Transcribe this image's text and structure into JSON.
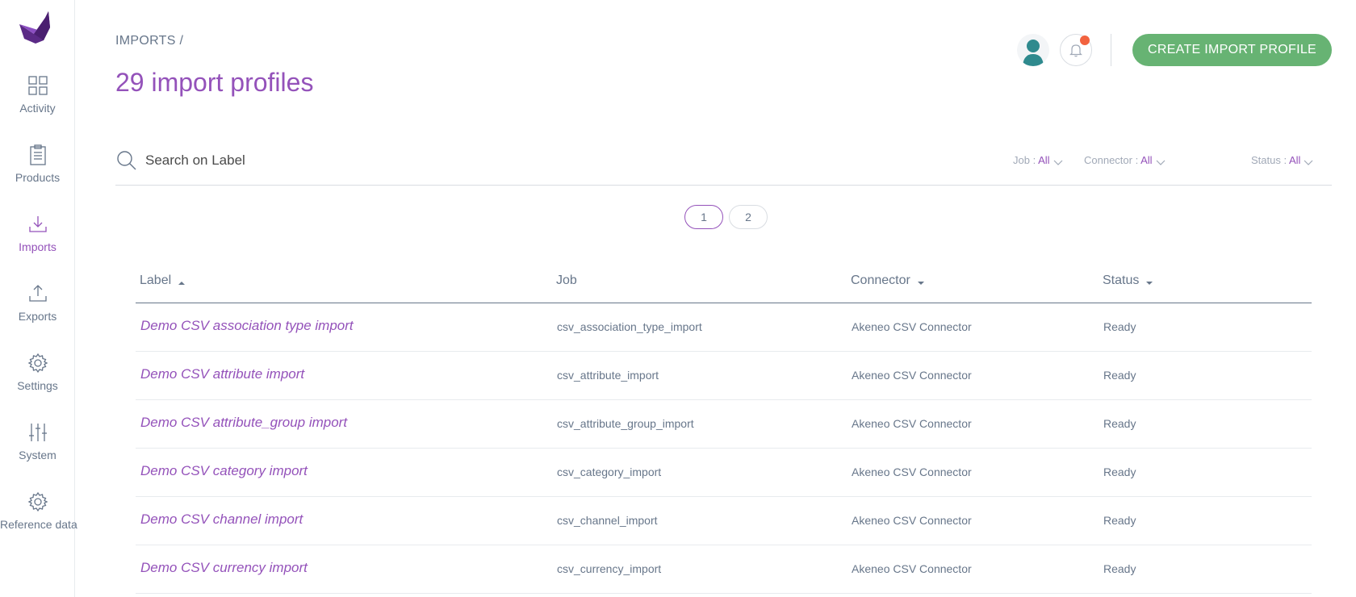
{
  "sidebar": {
    "items": [
      {
        "label": "Activity",
        "icon": "dashboard-grid-icon"
      },
      {
        "label": "Products",
        "icon": "clipboard-icon"
      },
      {
        "label": "Imports",
        "icon": "import-icon",
        "active": true
      },
      {
        "label": "Exports",
        "icon": "export-icon"
      },
      {
        "label": "Settings",
        "icon": "gear-icon"
      },
      {
        "label": "System",
        "icon": "sliders-icon"
      },
      {
        "label": "Reference data",
        "icon": "gear-icon"
      }
    ]
  },
  "header": {
    "breadcrumb": "IMPORTS /",
    "title": "29 import profiles",
    "create_button": "CREATE IMPORT PROFILE"
  },
  "search": {
    "placeholder": "Search on Label"
  },
  "filters": [
    {
      "label": "Job : ",
      "value": "All"
    },
    {
      "label": "Connector : ",
      "value": "All"
    },
    {
      "label": "Status : ",
      "value": "All"
    }
  ],
  "pagination": {
    "pages": [
      "1",
      "2"
    ],
    "current": "1"
  },
  "table": {
    "columns": [
      "Label",
      "Job",
      "Connector",
      "Status"
    ],
    "rows": [
      {
        "label": "Demo CSV association type import",
        "job": "csv_association_type_import",
        "connector": "Akeneo CSV Connector",
        "status": "Ready"
      },
      {
        "label": "Demo CSV attribute import",
        "job": "csv_attribute_import",
        "connector": "Akeneo CSV Connector",
        "status": "Ready"
      },
      {
        "label": "Demo CSV attribute_group import",
        "job": "csv_attribute_group_import",
        "connector": "Akeneo CSV Connector",
        "status": "Ready"
      },
      {
        "label": "Demo CSV category import",
        "job": "csv_category_import",
        "connector": "Akeneo CSV Connector",
        "status": "Ready"
      },
      {
        "label": "Demo CSV channel import",
        "job": "csv_channel_import",
        "connector": "Akeneo CSV Connector",
        "status": "Ready"
      },
      {
        "label": "Demo CSV currency import",
        "job": "csv_currency_import",
        "connector": "Akeneo CSV Connector",
        "status": "Ready"
      }
    ]
  },
  "colors": {
    "brand_purple": "#9452ba",
    "create_green": "#67b373",
    "notification_dot": "#f2623f",
    "text_grey": "#67768a"
  }
}
